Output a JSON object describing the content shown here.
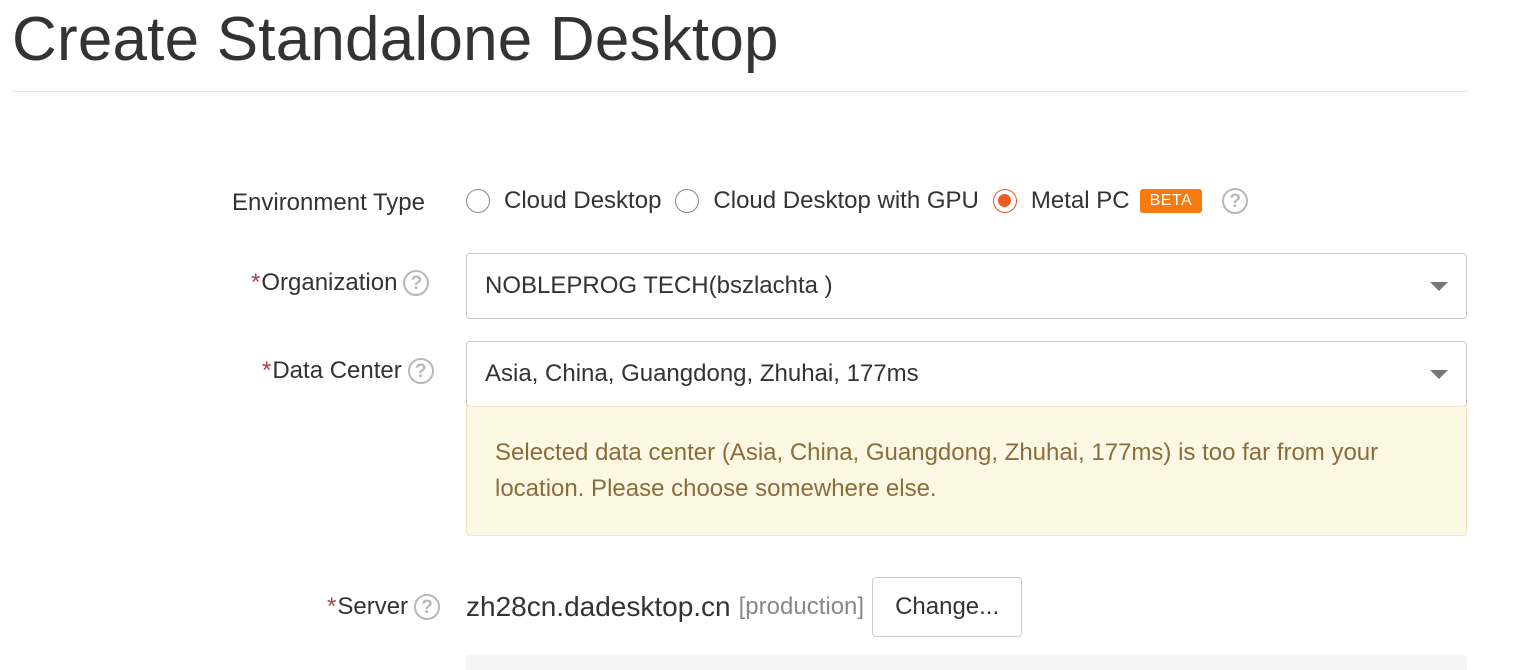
{
  "page": {
    "title": "Create Standalone Desktop"
  },
  "form": {
    "environment_type": {
      "label": "Environment Type",
      "options": [
        {
          "label": "Cloud Desktop",
          "checked": false
        },
        {
          "label": "Cloud Desktop with GPU",
          "checked": false
        },
        {
          "label": "Metal PC",
          "checked": true,
          "badge": "BETA"
        }
      ],
      "help": "?"
    },
    "organization": {
      "required": "*",
      "label": "Organization",
      "help": "?",
      "value": "NOBLEPROG TECH(bszlachta )"
    },
    "data_center": {
      "required": "*",
      "label": "Data Center",
      "help": "?",
      "value": "Asia, China, Guangdong, Zhuhai, 177ms",
      "warning": "Selected data center (Asia, China, Guangdong, Zhuhai, 177ms) is too far from your location. Please choose somewhere else."
    },
    "server": {
      "required": "*",
      "label": "Server",
      "help": "?",
      "name": "zh28cn.dadesktop.cn",
      "environment": "[production]",
      "change_label": "Change..."
    }
  },
  "colors": {
    "accent": "#f05a24",
    "badge": "#f77a0f",
    "required": "#a94442",
    "warning_bg": "#fcf8e3",
    "warning_text": "#8a6d3b"
  },
  "icons": {
    "help": "question-circle-icon",
    "dropdown": "caret-down-icon"
  }
}
